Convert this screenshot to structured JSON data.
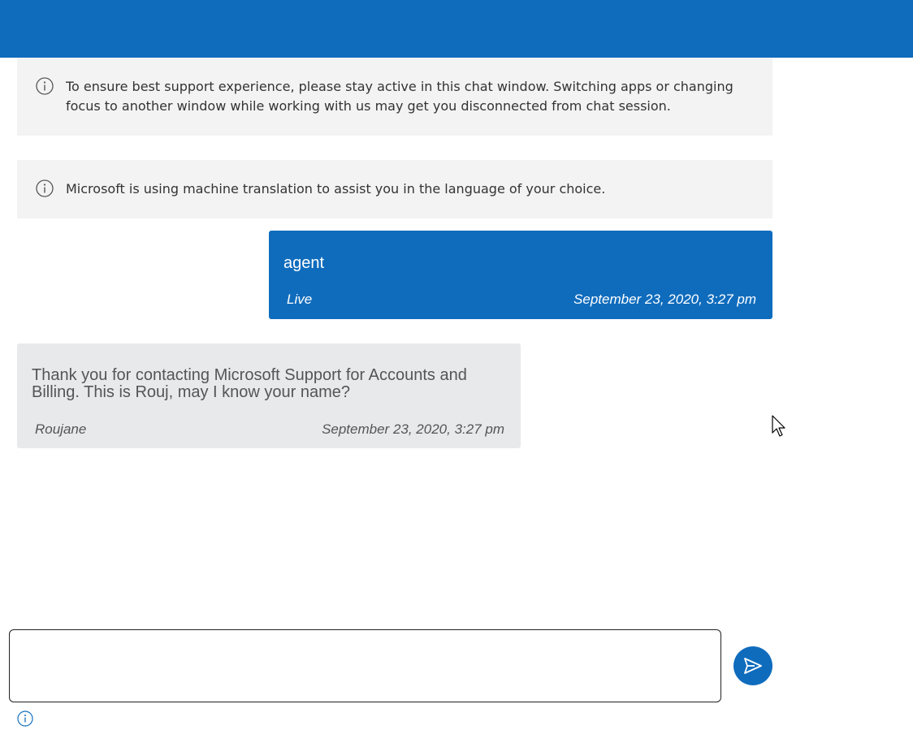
{
  "notices": [
    {
      "icon": "info-icon",
      "text": "To ensure best support experience, please stay active in this chat window. Switching apps or changing focus to another window while working with us may get you disconnected from chat session."
    },
    {
      "icon": "info-icon",
      "text": "Microsoft is using machine translation to assist you in the language of your choice."
    }
  ],
  "messages": [
    {
      "text": "agent",
      "sender": "Live",
      "time": "September 23, 2020, 3:27 pm"
    },
    {
      "text": "Thank you for contacting Microsoft Support for Accounts and Billing. This is Rouj, may I know your name?",
      "sender": "Roujane",
      "time": "September 23, 2020, 3:27 pm"
    }
  ],
  "composer": {
    "value": "",
    "send_icon": "send-icon",
    "footer_icon": "info-icon"
  },
  "colors": {
    "brand": "#0f6cbd",
    "notice_bg": "#f3f3f3",
    "support_bubble_bg": "#e8e9ea"
  }
}
